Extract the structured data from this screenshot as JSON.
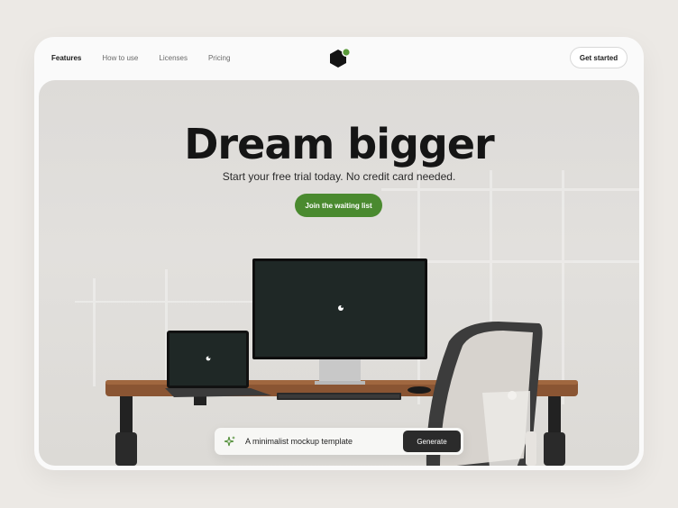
{
  "nav": {
    "links": [
      {
        "label": "Features",
        "active": true
      },
      {
        "label": "How to use",
        "active": false
      },
      {
        "label": "Licenses",
        "active": false
      },
      {
        "label": "Pricing",
        "active": false
      }
    ],
    "cta_label": "Get started",
    "logo_icon": "hexagon-logo-icon"
  },
  "hero": {
    "title": "Dream bigger",
    "subtitle": "Start your free trial today. No credit card needed.",
    "button_label": "Join the waiting list"
  },
  "prompt": {
    "value": "A minimalist mockup template",
    "icon": "sparkle-icon",
    "button_label": "Generate"
  },
  "colors": {
    "accent_green": "#4a8a2f",
    "dark": "#1b1b1b",
    "screen": "#1f2826"
  }
}
